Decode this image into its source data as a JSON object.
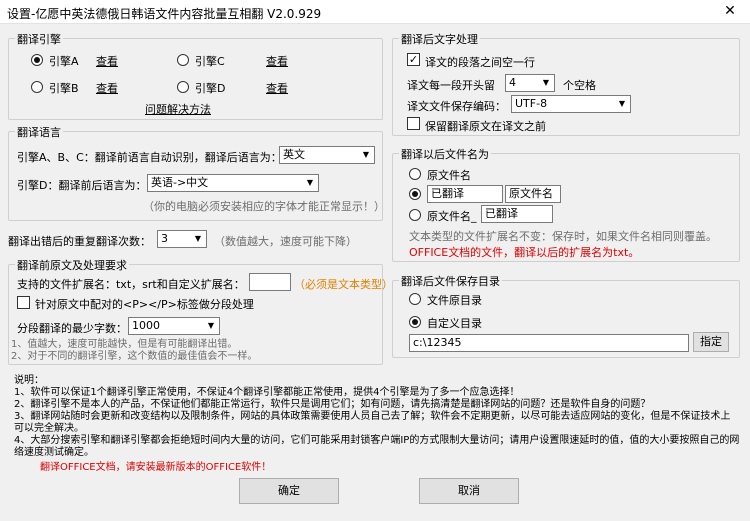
{
  "window": {
    "title": "设置-亿愿中英法德俄日韩语文件内容批量互相翻 V2.0.929",
    "close_glyph": "✕"
  },
  "engines": {
    "legend": "翻译引擎",
    "items": [
      {
        "label": "引擎A",
        "view": "查看",
        "selected": true
      },
      {
        "label": "引擎C",
        "view": "查看",
        "selected": false
      },
      {
        "label": "引擎B",
        "view": "查看",
        "selected": false
      },
      {
        "label": "引擎D",
        "view": "查看",
        "selected": false
      }
    ],
    "help_link": "问题解决方法"
  },
  "language": {
    "legend": "翻译语言",
    "abc_label": "引擎A、B、C：翻译前语言自动识别，翻译后语言为：",
    "abc_value": "英文",
    "d_label": "引擎D：翻译前后语言为：",
    "d_value": "英语->中文",
    "font_note": "（你的电脑必须安装相应的字体才能正常显示！）"
  },
  "retry": {
    "label": "翻译出错后的重复翻译次数：",
    "value": "3",
    "note": "（数值越大，速度可能下降）"
  },
  "pre": {
    "legend": "翻译前原文及处理要求",
    "ext_label": "支持的文件扩展名：txt，srt和自定义扩展名：",
    "ext_value": "",
    "ext_note": "（必须是文本类型）",
    "tag_label": "针对原文中配对的<P></P>标签做分段处理",
    "min_label": "分段翻译的最少字数：",
    "min_value": "1000",
    "note1": "1、值越大，速度可能越快，但是有可能翻译出错。",
    "note2": "2、对于不同的翻译引擎，这个数值的最佳值会不一样。"
  },
  "post": {
    "legend": "翻译后文字处理",
    "blank_line_label": "译文的段落之间空一行",
    "blank_line_checked": true,
    "indent_label": "译文每一段开头留",
    "indent_value": "4",
    "indent_unit": "个空格",
    "encoding_label": "译文文件保存编码：",
    "encoding_value": "UTF-8",
    "keep_original_label": "保留翻译原文在译文之前",
    "keep_original_checked": false
  },
  "filename": {
    "legend": "翻译以后文件名为",
    "opt1": "原文件名",
    "opt2_prefix": "已翻译",
    "opt2_suffix": "原文件名",
    "opt3_prefix": "原文件名_",
    "opt3_value": "已翻译",
    "note": "文本类型的文件扩展名不变：保存时，如果文件名相同则覆盖。",
    "office_note": "OFFICE文档的文件，翻译以后的扩展名为txt。"
  },
  "savedir": {
    "legend": "翻译后文件保存目录",
    "opt1": "文件原目录",
    "opt2": "自定义目录",
    "path": "c:\\12345",
    "browse": "指定"
  },
  "notes": {
    "title": "说明：",
    "line1": "1、软件可以保证1个翻译引擎正常使用，不保证4个翻译引擎都能正常使用，提供4个引擎是为了多一个应急选择！",
    "line2": "2、翻译引擎不是本人的产品，不保证他们都能正常运行，软件只是调用它们；如有问题，请先搞清楚是翻译网站的问题？还是软件自身的问题？",
    "line3": "3、翻译网站随时会更新和改变结构以及限制条件，网站的具体政策需要使用人员自己去了解；软件会不定期更新，以尽可能去适应网站的变化，但是不保证技术上可以完全解决。",
    "line4": "4、大部分搜索引擎和翻译引擎都会拒绝短时间内大量的访问，它们可能采用封锁客户端IP的方式限制大量访问；请用户设置限速延时的值，值的大小要按照自己的网络速度测试确定。",
    "office_warning": "翻译OFFICE文档，请安装最新版本的OFFICE软件！"
  },
  "buttons": {
    "ok": "确定",
    "cancel": "取消"
  }
}
